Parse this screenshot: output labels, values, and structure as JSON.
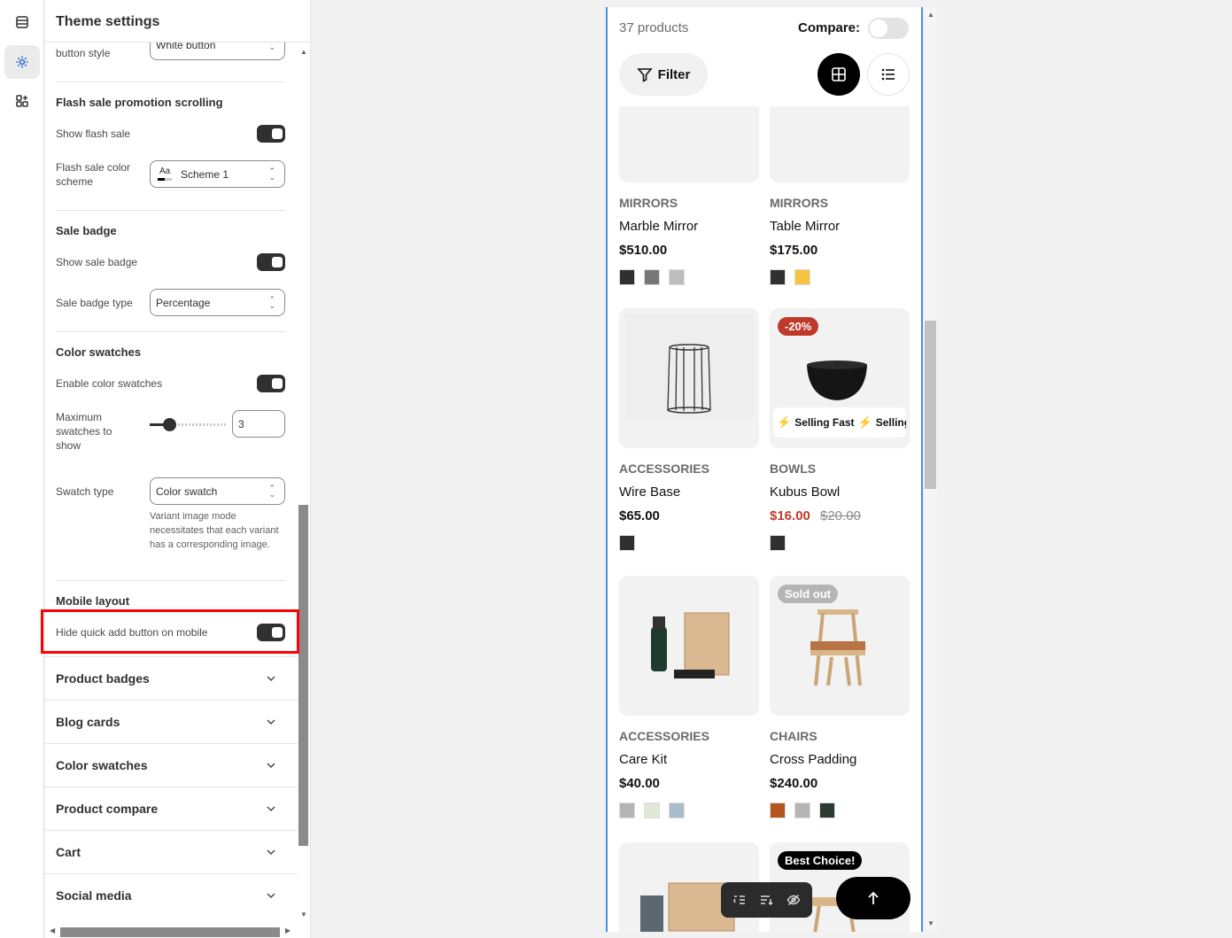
{
  "panel": {
    "title": "Theme settings",
    "button_style_label": "button style",
    "button_style_value": "White button",
    "flash": {
      "title": "Flash sale promotion scrolling",
      "show_label": "Show flash sale",
      "scheme_label": "Flash sale color scheme",
      "scheme_value": "Scheme 1",
      "scheme_icon_text": "Aa"
    },
    "sale_badge": {
      "title": "Sale badge",
      "show_label": "Show sale badge",
      "type_label": "Sale badge type",
      "type_value": "Percentage"
    },
    "swatches": {
      "title": "Color swatches",
      "enable_label": "Enable color swatches",
      "max_label": "Maximum swatches to show",
      "max_value": "3",
      "slider_fraction": 0.2,
      "type_label": "Swatch type",
      "type_value": "Color swatch",
      "help": "Variant image mode necessitates that each variant has a corresponding image."
    },
    "mobile": {
      "title": "Mobile layout",
      "hide_label": "Hide quick add button on mobile"
    },
    "accordions": [
      "Product badges",
      "Blog cards",
      "Color swatches",
      "Product compare",
      "Cart",
      "Social media"
    ]
  },
  "preview": {
    "count": "37 products",
    "compare_label": "Compare:",
    "filter_label": "Filter",
    "products": [
      {
        "category": "MIRRORS",
        "name": "Marble Mirror",
        "price": "$510.00",
        "swatches": [
          "#303030",
          "#777777",
          "#bdbdbd"
        ]
      },
      {
        "category": "MIRRORS",
        "name": "Table Mirror",
        "price": "$175.00",
        "swatches": [
          "#303030",
          "#f6c343"
        ]
      },
      {
        "category": "ACCESSORIES",
        "name": "Wire Base",
        "price": "$65.00",
        "swatches": [
          "#303030"
        ]
      },
      {
        "category": "BOWLS",
        "name": "Kubus Bowl",
        "price": "$16.00",
        "old_price": "$20.00",
        "badge": "-20%",
        "marquee": "Selling Fast",
        "swatches": [
          "#303030"
        ]
      },
      {
        "category": "ACCESSORIES",
        "name": "Care Kit",
        "price": "$40.00",
        "swatches": [
          "#b5b5b5",
          "#dfe9d6",
          "#a9bcc9"
        ]
      },
      {
        "category": "CHAIRS",
        "name": "Cross Padding",
        "price": "$240.00",
        "badge": "Sold out",
        "swatches": [
          "#b5561e",
          "#b5b5b5",
          "#2d3a33"
        ]
      }
    ],
    "bottom_badge": "Best Choice!"
  },
  "colors": {
    "accent": "#4a90e2",
    "sale_red": "#c0392b",
    "highlight": "#ff0000"
  }
}
